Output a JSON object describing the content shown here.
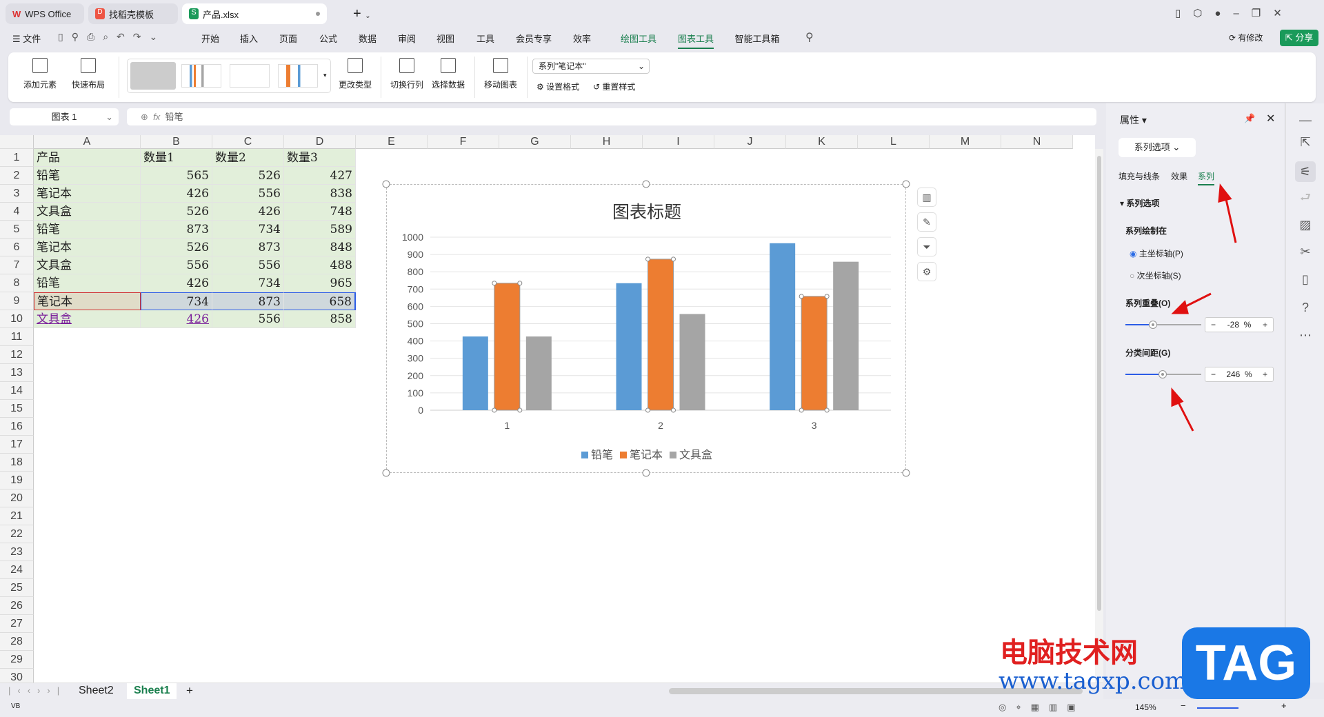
{
  "tabs": [
    {
      "label": "WPS Office",
      "icon": "wps-logo-icon"
    },
    {
      "label": "找稻壳模板",
      "icon": "docer-icon"
    },
    {
      "label": "产品.xlsx",
      "icon": "spreadsheet-icon",
      "active": true
    }
  ],
  "menu": {
    "file": "文件",
    "items": [
      "开始",
      "插入",
      "页面",
      "公式",
      "数据",
      "审阅",
      "视图",
      "工具",
      "会员专享",
      "效率",
      "绘图工具",
      "图表工具",
      "智能工具箱"
    ],
    "active": "图表工具",
    "modified": "有修改",
    "share": "分享"
  },
  "ribbon": {
    "add_element": "添加元素",
    "quick_layout": "快速布局",
    "change_type": "更改类型",
    "switch_row_col": "切换行列",
    "select_data": "选择数据",
    "move_chart": "移动图表",
    "series_select": "系列\"笔记本\"",
    "set_format": "设置格式",
    "reset_style": "重置样式"
  },
  "formula": {
    "name_box": "图表 1",
    "fx": "fx",
    "value": "铅笔"
  },
  "columns": [
    "A",
    "B",
    "C",
    "D",
    "E",
    "F",
    "G",
    "H",
    "I",
    "J",
    "K",
    "L",
    "M",
    "N"
  ],
  "rows": [
    [
      "产品",
      "数量1",
      "数量2",
      "数量3"
    ],
    [
      "铅笔",
      "565",
      "526",
      "427"
    ],
    [
      "笔记本",
      "426",
      "556",
      "838"
    ],
    [
      "文具盒",
      "526",
      "426",
      "748"
    ],
    [
      "铅笔",
      "873",
      "734",
      "589"
    ],
    [
      "笔记本",
      "526",
      "873",
      "848"
    ],
    [
      "文具盒",
      "556",
      "556",
      "488"
    ],
    [
      "铅笔",
      "426",
      "734",
      "965"
    ],
    [
      "笔记本",
      "734",
      "873",
      "658"
    ],
    [
      "文具盒",
      "426",
      "556",
      "858"
    ]
  ],
  "row_count": 30,
  "sheets": {
    "tabs": [
      "Sheet2",
      "Sheet1"
    ],
    "active": "Sheet1",
    "add": "+"
  },
  "status": {
    "zoom": "145%"
  },
  "panel": {
    "title": "属性",
    "dropdown": "系列选项",
    "tabs": [
      "填充与线条",
      "效果",
      "系列"
    ],
    "active_tab": "系列",
    "section": "系列选项",
    "plot_on": "系列绘制在",
    "primary_axis": "主坐标轴(P)",
    "secondary_axis": "次坐标轴(S)",
    "overlap_label": "系列重叠(O)",
    "overlap_value": "-28",
    "gap_label": "分类间距(G)",
    "gap_value": "246",
    "percent": "%",
    "minus": "−",
    "plus": "+"
  },
  "watermark": {
    "site_cn": "电脑技术网",
    "url": "www.tagxp.com",
    "logo": "TAG"
  },
  "colors": {
    "accent": "#1a7f4e",
    "blue": "#5b9bd5",
    "orange": "#ed7d31",
    "gray": "#a5a5a5"
  },
  "chart_data": {
    "type": "bar",
    "title": "图表标题",
    "categories": [
      "1",
      "2",
      "3"
    ],
    "series": [
      {
        "name": "铅笔",
        "values": [
          426,
          734,
          965
        ],
        "color": "#5b9bd5"
      },
      {
        "name": "笔记本",
        "values": [
          734,
          873,
          658
        ],
        "color": "#ed7d31"
      },
      {
        "name": "文具盒",
        "values": [
          426,
          556,
          858
        ],
        "color": "#a5a5a5"
      }
    ],
    "ylim": [
      0,
      1000
    ],
    "yticks": [
      "0",
      "100",
      "200",
      "300",
      "400",
      "500",
      "600",
      "700",
      "800",
      "900",
      "1000"
    ],
    "grid": true,
    "legend": "bottom",
    "selected_series": "笔记本"
  }
}
